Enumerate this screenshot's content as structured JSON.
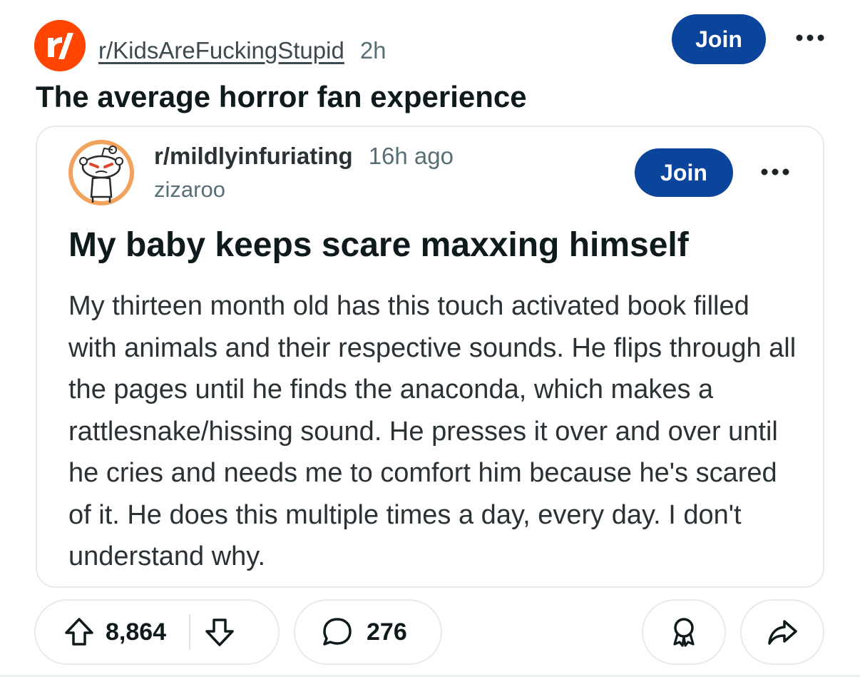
{
  "header": {
    "subreddit": "r/KidsAreFuckingStupid",
    "age": "2h",
    "join_label": "Join",
    "logo_icon": "reddit-r-logo-icon",
    "more_icon": "more-options-icon"
  },
  "post": {
    "title": "The average horror fan experience"
  },
  "crosspost": {
    "subreddit": "r/mildlyinfuriating",
    "age": "16h ago",
    "author": "zizaroo",
    "join_label": "Join",
    "title": "My baby keeps scare maxxing himself",
    "body": "My thirteen month old has this touch activated book filled with animals and their respective sounds. He flips through all the pages until he finds the anaconda, which makes a rattlesnake/hissing sound. He presses it over and over until he cries and needs me to comfort him because he's scared of it. He does this multiple times a day, every day. I don't understand why.",
    "avatar_icon": "angry-snoo-avatar-icon"
  },
  "actions": {
    "upvotes": "8,864",
    "comments": "276",
    "upvote_icon": "upvote-arrow-icon",
    "downvote_icon": "downvote-arrow-icon",
    "comment_icon": "comment-bubble-icon",
    "award_icon": "award-icon",
    "share_icon": "share-arrow-icon"
  },
  "colors": {
    "brand_orange": "#ff4500",
    "join_blue": "#0a449b",
    "text_primary": "#0f1a1c",
    "text_secondary": "#576f76",
    "border": "#e5ebee"
  }
}
